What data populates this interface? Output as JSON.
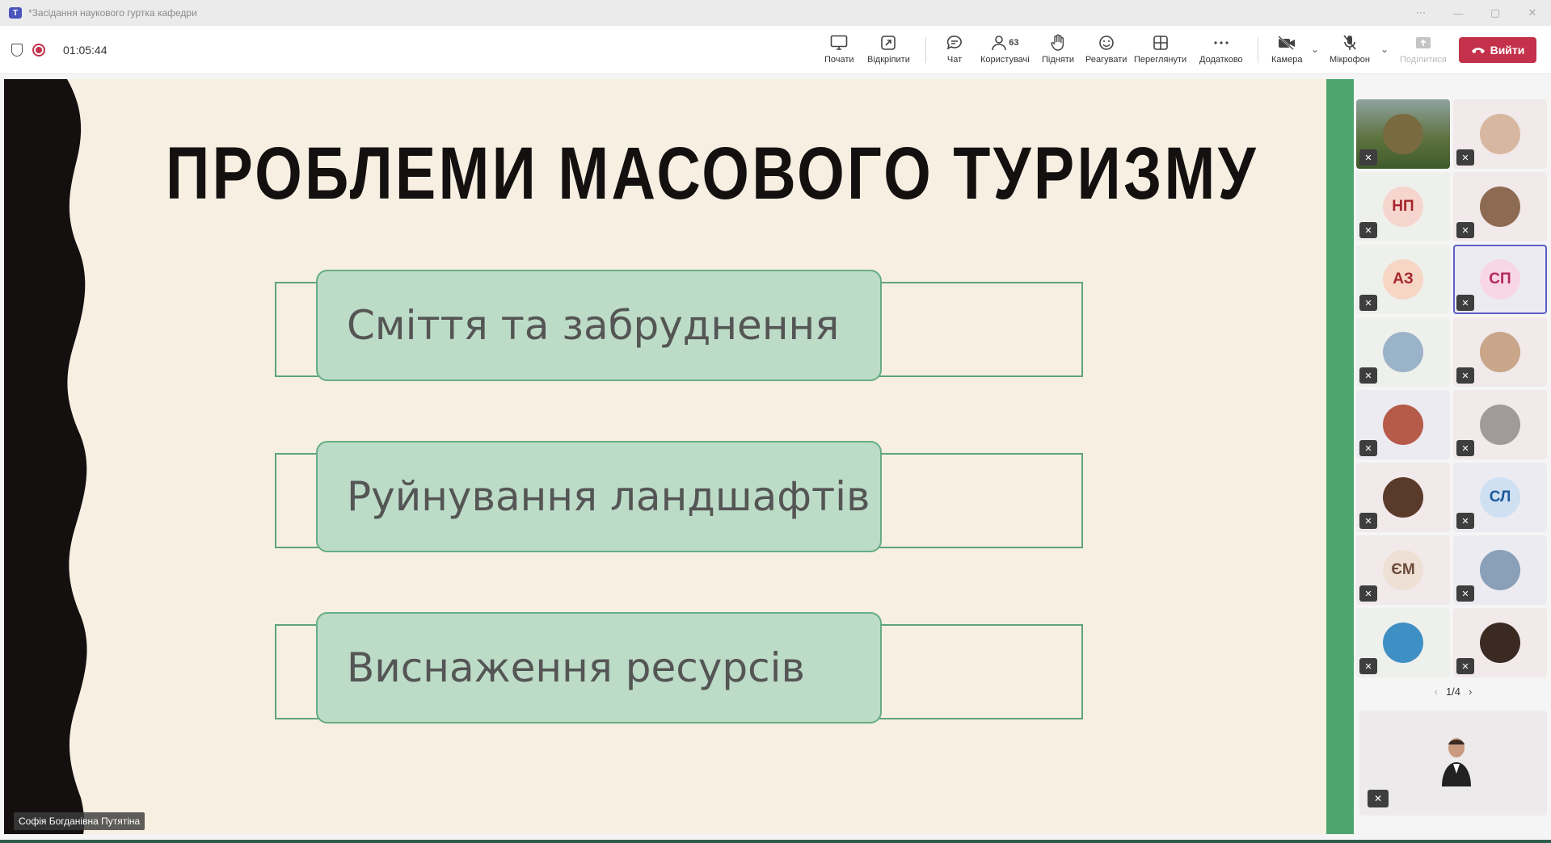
{
  "window": {
    "title": "*Засідання наукового гуртка кафедри",
    "controls": [
      "⋯",
      "—",
      "▢",
      "✕"
    ]
  },
  "meeting": {
    "timer": "01:05:44",
    "toolbar": {
      "start": "Почати",
      "popout": "Відкріпити",
      "chat": "Чат",
      "people": "Користувачі",
      "people_count": "63",
      "raise": "Підняти",
      "react": "Реагувати",
      "view": "Переглянути",
      "more": "Додатково",
      "camera": "Камера",
      "mic": "Мікрофон",
      "share": "Поділитися",
      "leave": "Вийти"
    }
  },
  "slide": {
    "title": "ПРОБЛЕМИ МАСОВОГО ТУРИЗМУ",
    "items": [
      "Сміття та забруднення",
      "Руйнування ландшафтів",
      "Виснаження ресурсів"
    ],
    "presenter": "Софія Богданівна Путятіна",
    "colors": {
      "background": "#f6efe2",
      "card": "#bcdcc8",
      "border": "#5ea37d",
      "wave": "#141010"
    }
  },
  "gallery": {
    "tiles": [
      {
        "initials": "",
        "kind": "photo",
        "color": "#7a6a40"
      },
      {
        "initials": "",
        "kind": "photo",
        "color": "#d7b7a0"
      },
      {
        "initials": "НП",
        "kind": "initials",
        "color": "#f6d5ce",
        "text_color": "#a4262c"
      },
      {
        "initials": "",
        "kind": "photo",
        "color": "#8d6b52"
      },
      {
        "initials": "АЗ",
        "kind": "initials",
        "color": "#f8d6c6",
        "text_color": "#a4262c"
      },
      {
        "initials": "СП",
        "kind": "initials",
        "color": "#f7d7e4",
        "text_color": "#b4275d"
      },
      {
        "initials": "",
        "kind": "photo",
        "color": "#9bb3c8"
      },
      {
        "initials": "",
        "kind": "photo",
        "color": "#c9a58a"
      },
      {
        "initials": "",
        "kind": "photo",
        "color": "#b65a4a"
      },
      {
        "initials": "",
        "kind": "photo",
        "color": "#a09a98"
      },
      {
        "initials": "",
        "kind": "photo",
        "color": "#5a3a2a"
      },
      {
        "initials": "СЛ",
        "kind": "initials",
        "color": "#cfe0f3",
        "text_color": "#1b5a9b"
      },
      {
        "initials": "ЄМ",
        "kind": "initials",
        "color": "#efe0d6",
        "text_color": "#6b4a3a"
      },
      {
        "initials": "",
        "kind": "photo",
        "color": "#8aa0b8"
      },
      {
        "initials": "",
        "kind": "photo",
        "color": "#3d8fc4"
      },
      {
        "initials": "",
        "kind": "photo",
        "color": "#3b2a22"
      }
    ],
    "page": "1/4"
  }
}
